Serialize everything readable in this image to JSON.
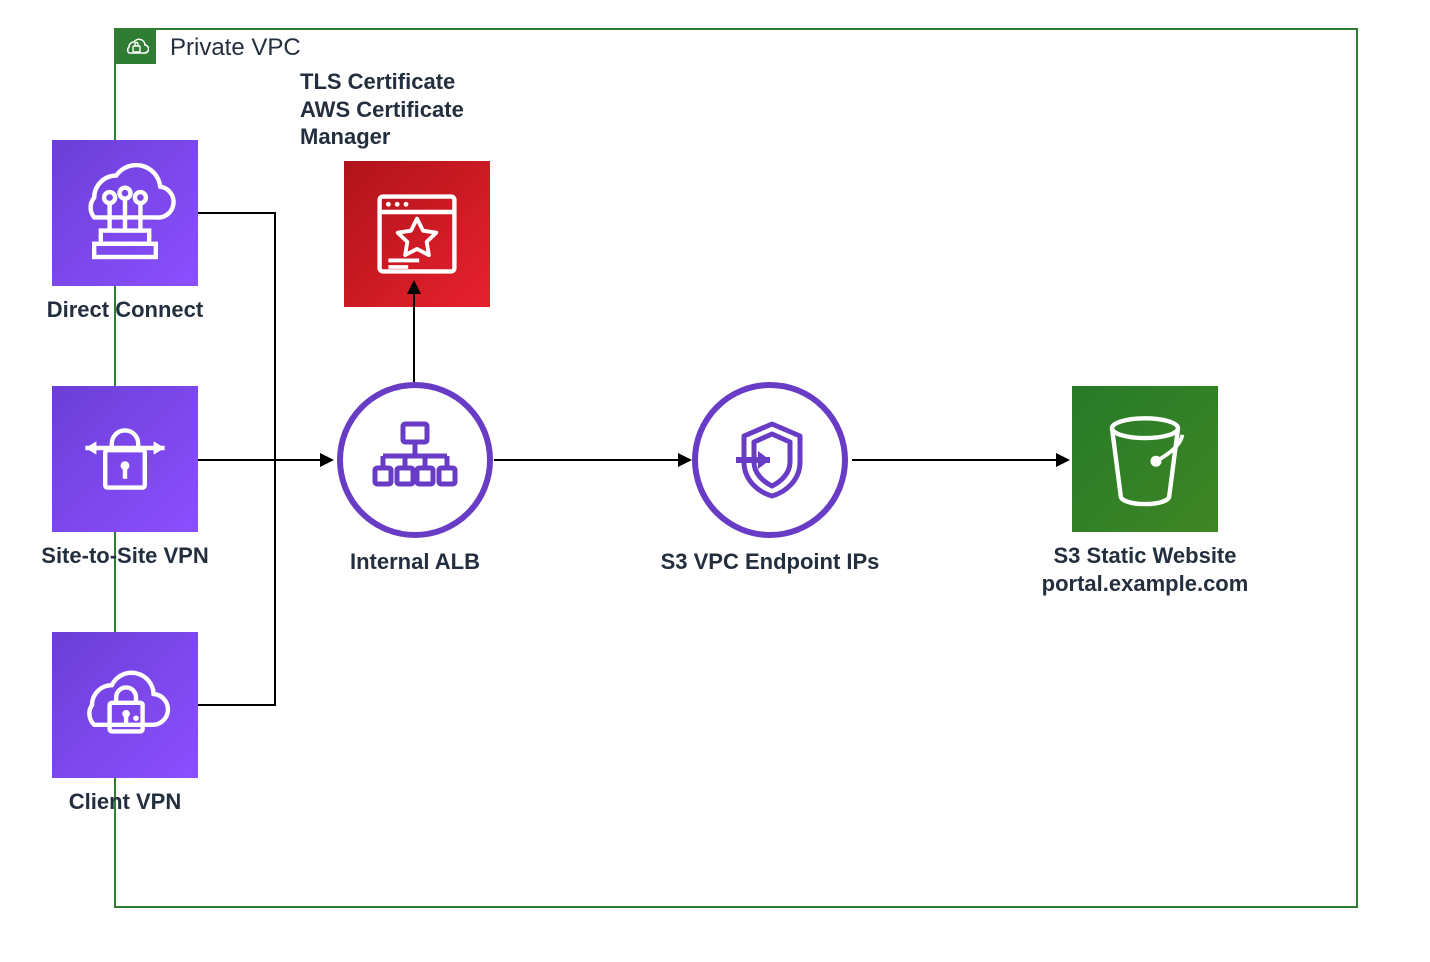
{
  "vpc": {
    "label": "Private VPC"
  },
  "nodes": {
    "direct_connect": {
      "label": "Direct Connect"
    },
    "site_vpn": {
      "label": "Site-to-Site VPN"
    },
    "client_vpn": {
      "label": "Client VPN"
    },
    "acm": {
      "label": "TLS Certificate\nAWS Certificate Manager"
    },
    "alb": {
      "label": "Internal ALB"
    },
    "s3_endpoint": {
      "label": "S3 VPC Endpoint IPs"
    },
    "s3_website": {
      "label": "S3 Static Website\nportal.example.com"
    }
  },
  "diagram": {
    "type": "architecture",
    "container": "Private VPC",
    "nodes": [
      {
        "id": "direct_connect",
        "service": "AWS Direct Connect"
      },
      {
        "id": "site_vpn",
        "service": "AWS Site-to-Site VPN"
      },
      {
        "id": "client_vpn",
        "service": "AWS Client VPN"
      },
      {
        "id": "acm",
        "service": "AWS Certificate Manager",
        "note": "TLS Certificate"
      },
      {
        "id": "alb",
        "service": "Internal Application Load Balancer"
      },
      {
        "id": "s3_endpoint",
        "service": "S3 VPC Endpoint (IP targets)"
      },
      {
        "id": "s3_website",
        "service": "Amazon S3 Static Website",
        "hostname": "portal.example.com"
      }
    ],
    "edges": [
      {
        "from": "direct_connect",
        "to": "alb"
      },
      {
        "from": "site_vpn",
        "to": "alb"
      },
      {
        "from": "client_vpn",
        "to": "alb"
      },
      {
        "from": "alb",
        "to": "acm"
      },
      {
        "from": "alb",
        "to": "s3_endpoint"
      },
      {
        "from": "s3_endpoint",
        "to": "s3_website"
      }
    ]
  },
  "colors": {
    "vpc_border": "#2E7D32",
    "networking_purple": "#8C4FFF",
    "security_red": "#E7212E",
    "storage_green": "#3F8624",
    "circle_stroke": "#693CC5"
  }
}
